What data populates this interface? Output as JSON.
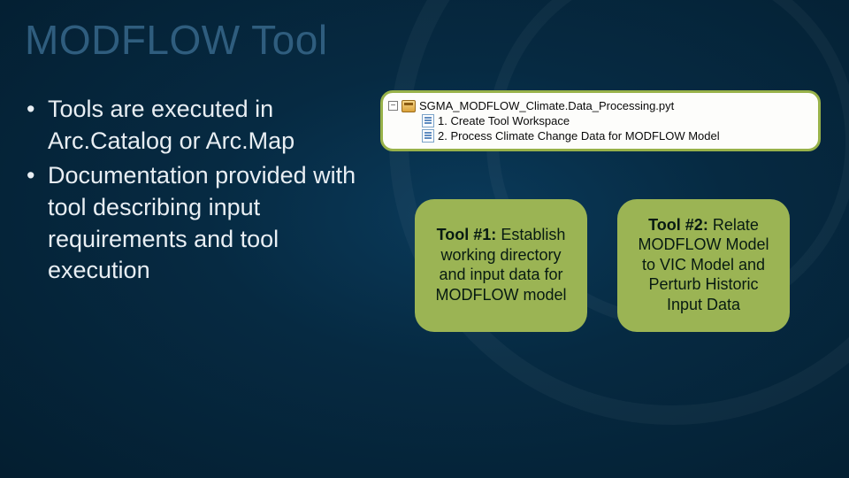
{
  "title": "MODFLOW Tool",
  "bullets": [
    "Tools are executed in Arc.Catalog or Arc.Map",
    "Documentation provided with tool describing input requirements and tool execution"
  ],
  "catalog": {
    "toolbox": "SGMA_MODFLOW_Climate.Data_Processing.pyt",
    "items": [
      "1. Create Tool Workspace",
      "2. Process Climate Change Data for MODFLOW Model"
    ]
  },
  "callouts": [
    {
      "lead": "Tool #1:",
      "rest": " Establish working directory and input data for MODFLOW model"
    },
    {
      "lead": "Tool #2:",
      "rest": " Relate MODFLOW Model to VIC Model and Perturb Historic Input Data"
    }
  ]
}
